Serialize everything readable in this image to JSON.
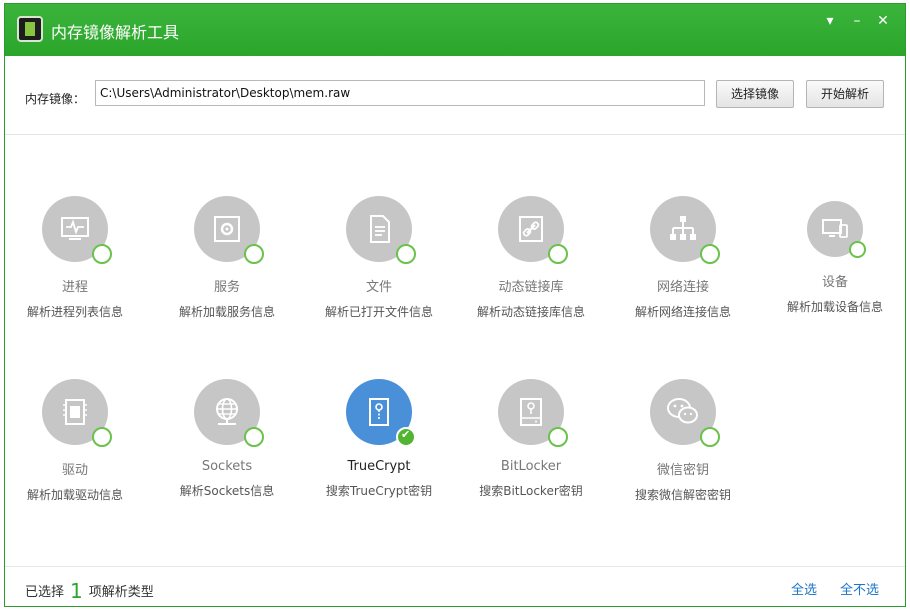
{
  "window": {
    "title": "内存镜像解析工具"
  },
  "titlebar_buttons": {
    "menu": "▾",
    "minimize": "–",
    "close": "✕"
  },
  "toolbar": {
    "path_label": "内存镜像：",
    "path_value": "C:\\Users\\Administrator\\Desktop\\mem.raw",
    "select_button": "选择镜像",
    "start_button": "开始解析"
  },
  "items": [
    {
      "name": "进程",
      "desc": "解析进程列表信息",
      "icon": "monitor-icon",
      "selected": false
    },
    {
      "name": "服务",
      "desc": "解析加载服务信息",
      "icon": "service-gear-icon",
      "selected": false
    },
    {
      "name": "文件",
      "desc": "解析已打开文件信息",
      "icon": "file-icon",
      "selected": false
    },
    {
      "name": "动态链接库",
      "desc": "解析动态链接库信息",
      "icon": "link-icon",
      "selected": false
    },
    {
      "name": "网络连接",
      "desc": "解析网络连接信息",
      "icon": "network-icon",
      "selected": false
    },
    {
      "name": "设备",
      "desc": "解析加载设备信息",
      "icon": "device-icon",
      "selected": false
    },
    {
      "name": "驱动",
      "desc": "解析加载驱动信息",
      "icon": "chip-icon",
      "selected": false
    },
    {
      "name": "Sockets",
      "desc": "解析Sockets信息",
      "icon": "globe-icon",
      "selected": false
    },
    {
      "name": "TrueCrypt",
      "desc": "搜索TrueCrypt密钥",
      "icon": "truecrypt-icon",
      "selected": true
    },
    {
      "name": "BitLocker",
      "desc": "搜索BitLocker密钥",
      "icon": "drive-key-icon",
      "selected": false
    },
    {
      "name": "微信密钥",
      "desc": "搜索微信解密密钥",
      "icon": "wechat-icon",
      "selected": false
    }
  ],
  "footer": {
    "selected_prefix": "已选择",
    "selected_count": "1",
    "selected_suffix": "项解析类型",
    "select_all": "全选",
    "select_none": "全不选"
  },
  "colors": {
    "titlebar": "#2ea52e",
    "selected_icon": "#4a90d9",
    "link": "#1c75c9"
  }
}
